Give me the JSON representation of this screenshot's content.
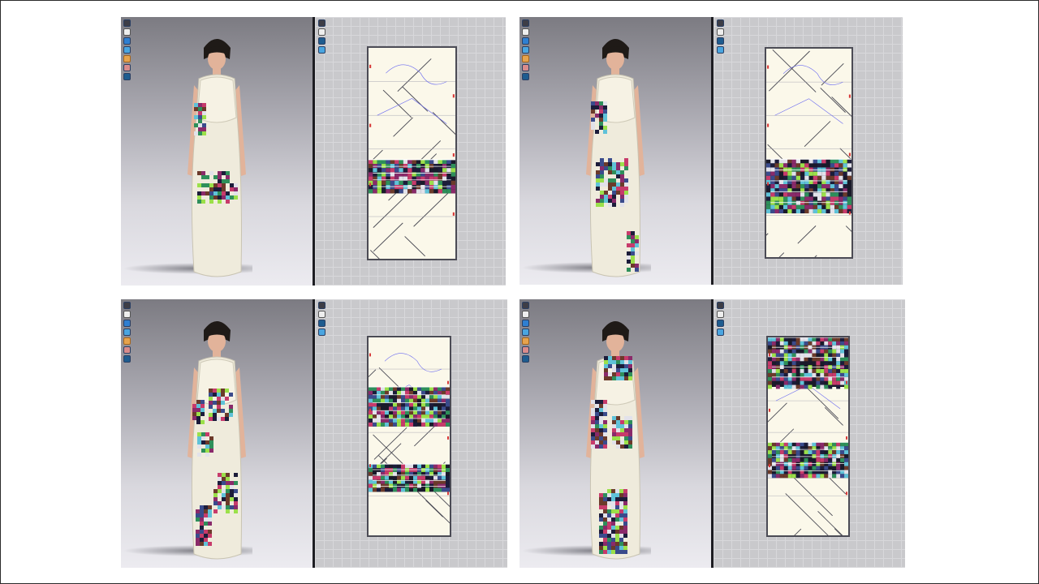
{
  "slide": {
    "panels": [
      {
        "id": "panel-1",
        "print_band_1": {
          "top": 0.53,
          "height": 0.16
        },
        "print_band_2": null,
        "dress_print": "light"
      },
      {
        "id": "panel-2",
        "print_band_1": {
          "top": 0.53,
          "height": 0.26
        },
        "print_band_2": null,
        "dress_print": "medium"
      },
      {
        "id": "panel-3",
        "print_band_1": {
          "top": 0.25,
          "height": 0.2
        },
        "print_band_2": {
          "top": 0.64,
          "height": 0.14
        },
        "dress_print": "medium"
      },
      {
        "id": "panel-4",
        "print_band_1": {
          "top": 0.0,
          "height": 0.25
        },
        "print_band_2": {
          "top": 0.53,
          "height": 0.18
        },
        "dress_print": "heavy"
      }
    ],
    "colors": {
      "sheet": "#fbf8ea",
      "outline": "#4b4b55",
      "print": [
        "#1c1c3a",
        "#3a4b8c",
        "#8a2a6a",
        "#2e8f5a",
        "#c73b6b",
        "#5fc2d8",
        "#e2e2ea",
        "#6b3a2a",
        "#9be04a"
      ],
      "avatar_skin": "#e2b39a",
      "hair": "#1f1a17",
      "dress": "#efebdc"
    },
    "icons": [
      "move-tool-icon",
      "select-tool-icon",
      "texture-tool-icon",
      "fabric-tool-icon",
      "pen-tool-icon",
      "avatar-tool-icon",
      "zoom-tool-icon"
    ]
  }
}
